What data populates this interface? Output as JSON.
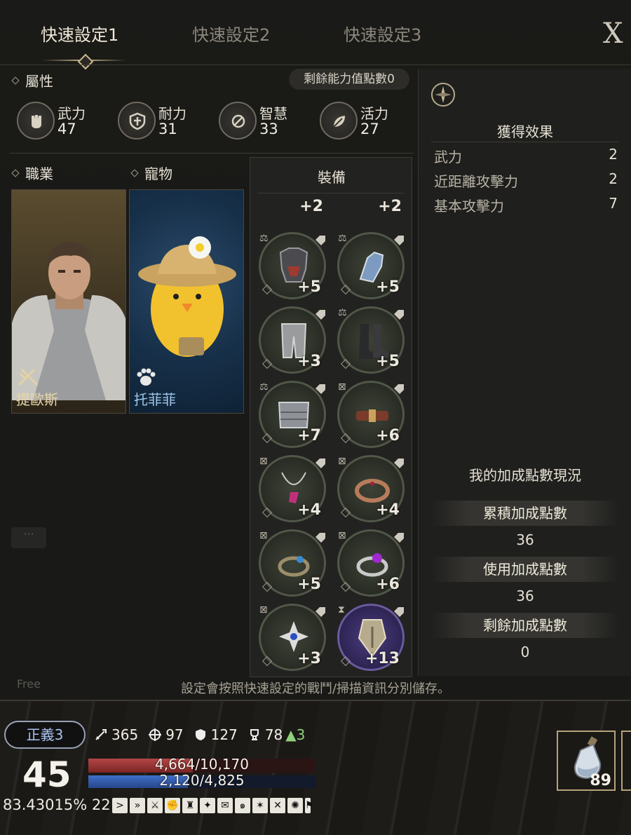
{
  "tabs": [
    {
      "label": "快速設定1",
      "active": true
    },
    {
      "label": "快速設定2",
      "active": false
    },
    {
      "label": "快速設定3",
      "active": false
    }
  ],
  "close_label": "X",
  "attributes": {
    "title": "屬性",
    "remaining": "剩餘能力值點數0",
    "stats": [
      {
        "label": "武力",
        "value": "47",
        "icon": "fist-icon"
      },
      {
        "label": "耐力",
        "value": "31",
        "icon": "shield-icon"
      },
      {
        "label": "智慧",
        "value": "33",
        "icon": "wisdom-icon"
      },
      {
        "label": "活力",
        "value": "27",
        "icon": "leaf-icon"
      }
    ]
  },
  "job": {
    "title": "職業",
    "name": "提歐斯"
  },
  "pet": {
    "title": "寵物",
    "name": "托菲菲"
  },
  "equipment": {
    "title": "裝備",
    "top_partial": [
      "+2",
      "+2"
    ],
    "slots": [
      {
        "plus": "+5",
        "mark": "scale",
        "item": "armor"
      },
      {
        "plus": "+5",
        "mark": "scale",
        "item": "gauntlet"
      },
      {
        "plus": "+3",
        "mark": "",
        "item": "pants"
      },
      {
        "plus": "+5",
        "mark": "scale",
        "item": "boots"
      },
      {
        "plus": "+7",
        "mark": "scale",
        "item": "cloak"
      },
      {
        "plus": "+6",
        "mark": "lock",
        "item": "belt"
      },
      {
        "plus": "+4",
        "mark": "lock",
        "item": "necklace"
      },
      {
        "plus": "+4",
        "mark": "lock",
        "item": "bracelet"
      },
      {
        "plus": "+5",
        "mark": "lock",
        "item": "ring"
      },
      {
        "plus": "+6",
        "mark": "lock",
        "item": "ring2"
      },
      {
        "plus": "+3",
        "mark": "lock",
        "item": "emblem"
      },
      {
        "plus": "+13",
        "mark": "hourglass",
        "item": "crest"
      }
    ]
  },
  "effects": {
    "title": "獲得效果",
    "rows": [
      {
        "key": "武力",
        "value": "2"
      },
      {
        "key": "近距離攻擊力",
        "value": "2"
      },
      {
        "key": "基本攻擊力",
        "value": "7"
      }
    ]
  },
  "bonus": {
    "title": "我的加成點數現況",
    "accumulated_label": "累積加成點數",
    "accumulated_value": "36",
    "used_label": "使用加成點數",
    "used_value": "36",
    "remaining_label": "剩餘加成點數",
    "remaining_value": "0"
  },
  "footer_note": "設定會按照快速設定的戰鬥/掃描資訊分別儲存。",
  "hud": {
    "rank": "正義3",
    "attack": "365",
    "accuracy": "97",
    "defense": "127",
    "trophy": "78",
    "trophy_up": "▲3",
    "level": "45",
    "hp_text": "4,664/10,170",
    "hp_fraction": 0.4586,
    "mp_text": "2,120/4,825",
    "mp_fraction": 0.4394,
    "exp": "83.43015%",
    "buff_count": "22",
    "potion_count": "89"
  }
}
